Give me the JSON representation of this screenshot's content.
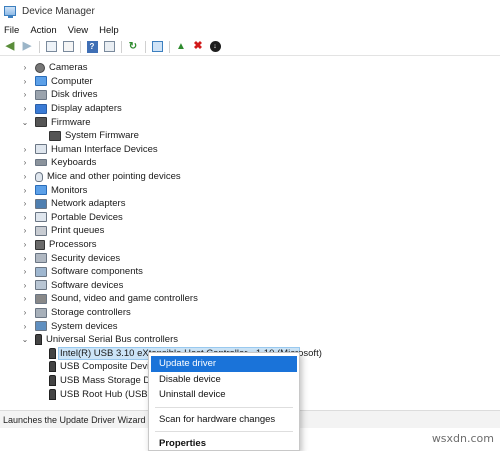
{
  "window": {
    "title": "Device Manager"
  },
  "menu": [
    "File",
    "Action",
    "View",
    "Help"
  ],
  "tree": {
    "categories": [
      {
        "label": "Cameras",
        "icon": "camera-icon",
        "expanded": false
      },
      {
        "label": "Computer",
        "icon": "computer-icon",
        "expanded": false
      },
      {
        "label": "Disk drives",
        "icon": "disk-icon",
        "expanded": false
      },
      {
        "label": "Display adapters",
        "icon": "display-adapter-icon",
        "expanded": false
      },
      {
        "label": "Firmware",
        "icon": "firmware-icon",
        "expanded": true
      },
      {
        "label": "System Firmware",
        "icon": "firmware-icon",
        "child": true
      },
      {
        "label": "Human Interface Devices",
        "icon": "hid-icon",
        "expanded": false
      },
      {
        "label": "Keyboards",
        "icon": "keyboard-icon",
        "expanded": false
      },
      {
        "label": "Mice and other pointing devices",
        "icon": "mouse-icon",
        "expanded": false
      },
      {
        "label": "Monitors",
        "icon": "monitor-icon",
        "expanded": false
      },
      {
        "label": "Network adapters",
        "icon": "network-icon",
        "expanded": false
      },
      {
        "label": "Portable Devices",
        "icon": "portable-device-icon",
        "expanded": false
      },
      {
        "label": "Print queues",
        "icon": "printer-icon",
        "expanded": false
      },
      {
        "label": "Processors",
        "icon": "processor-icon",
        "expanded": false
      },
      {
        "label": "Security devices",
        "icon": "security-icon",
        "expanded": false
      },
      {
        "label": "Software components",
        "icon": "software-component-icon",
        "expanded": false
      },
      {
        "label": "Software devices",
        "icon": "software-device-icon",
        "expanded": false
      },
      {
        "label": "Sound, video and game controllers",
        "icon": "sound-icon",
        "expanded": false
      },
      {
        "label": "Storage controllers",
        "icon": "storage-icon",
        "expanded": false
      },
      {
        "label": "System devices",
        "icon": "system-device-icon",
        "expanded": false
      },
      {
        "label": "Universal Serial Bus controllers",
        "icon": "usb-icon",
        "expanded": true
      },
      {
        "label": "Intel(R) USB 3.10 eXtensible Host Controller - 1.10 (Microsoft)",
        "icon": "usb-icon",
        "child": true,
        "selected": true
      },
      {
        "label": "USB Composite Device",
        "icon": "usb-icon",
        "child": true
      },
      {
        "label": "USB Mass Storage Device",
        "icon": "usb-icon",
        "child": true
      },
      {
        "label": "USB Root Hub (USB 3.0)",
        "icon": "usb-icon",
        "child": true
      }
    ]
  },
  "context_menu": {
    "items": [
      "Update driver",
      "Disable device",
      "Uninstall device",
      "Scan for hardware changes",
      "Properties"
    ],
    "highlighted": "Update driver"
  },
  "status": {
    "text": "Launches the Update Driver Wizard for the selected device."
  },
  "watermark": "wsxdn.com",
  "colors": {
    "accent": "#1a73d9",
    "selection": "#cce4f7"
  }
}
